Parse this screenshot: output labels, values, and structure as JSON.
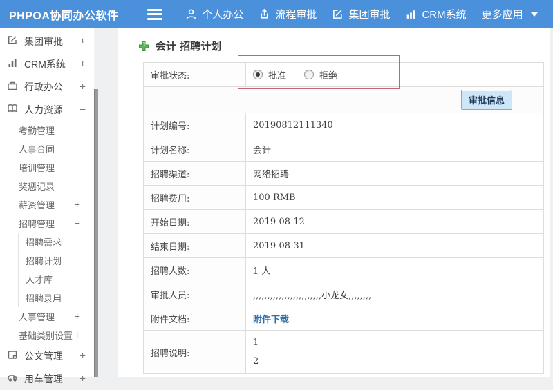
{
  "colors": {
    "topbar_blue": "#4b90db",
    "button_bg": "#cfe6f8",
    "link_blue": "#2f6fa7",
    "highlight_red": "#c4666b",
    "plus_green": "#55b055"
  },
  "topbar": {
    "brand": "PHPOA协同办公软件",
    "nav": [
      {
        "label": "个人办公",
        "icon": "person-icon"
      },
      {
        "label": "流程审批",
        "icon": "upload-icon"
      },
      {
        "label": "集团审批",
        "icon": "edit-icon"
      },
      {
        "label": "CRM系统",
        "icon": "bar-chart-icon"
      },
      {
        "label": "更多应用",
        "icon": "caret-down-icon"
      }
    ]
  },
  "sidebar": {
    "items": [
      {
        "label": "集团审批",
        "expand": "+",
        "icon": "edit-icon"
      },
      {
        "label": "CRM系统",
        "expand": "+",
        "icon": "bar-chart-icon"
      },
      {
        "label": "行政办公",
        "expand": "+",
        "icon": "briefcase-icon"
      },
      {
        "label": "人力资源",
        "expand": "−",
        "icon": "book-icon"
      },
      {
        "label": "考勤管理"
      },
      {
        "label": "人事合同"
      },
      {
        "label": "培训管理"
      },
      {
        "label": "奖惩记录"
      },
      {
        "label": "薪资管理",
        "expand": "+"
      },
      {
        "label": "招聘管理",
        "expand": "−"
      },
      {
        "label": "招聘需求"
      },
      {
        "label": "招聘计划"
      },
      {
        "label": "人才库"
      },
      {
        "label": "招聘录用"
      },
      {
        "label": "人事管理",
        "expand": "+"
      },
      {
        "label": "基础类别设置",
        "expand": "+"
      },
      {
        "label": "公文管理",
        "expand": "+",
        "icon": "document-icon"
      },
      {
        "label": "用车管理",
        "expand": "+",
        "icon": "car-icon"
      }
    ]
  },
  "main": {
    "title": "会计 招聘计划",
    "status": {
      "label": "审批状态:",
      "approve": "批准",
      "reject": "拒绝"
    },
    "approve_button": "审批信息",
    "rows": [
      {
        "label": "计划编号:",
        "value": "20190812111340"
      },
      {
        "label": "计划名称:",
        "value": "会计"
      },
      {
        "label": "招聘渠道:",
        "value": "网络招聘"
      },
      {
        "label": "招聘费用:",
        "value": "100 RMB"
      },
      {
        "label": "开始日期:",
        "value": "2019-08-12"
      },
      {
        "label": "结束日期:",
        "value": "2019-08-31"
      },
      {
        "label": "招聘人数:",
        "value": "1 人"
      },
      {
        "label": "审批人员:",
        "value": ",,,,,,,,,,,,,,,,,,,,,,,,小龙女,,,,,,,,"
      },
      {
        "label": "附件文档:",
        "value": "附件下载"
      },
      {
        "label": "招聘说明:",
        "value": "1\n2"
      }
    ]
  }
}
